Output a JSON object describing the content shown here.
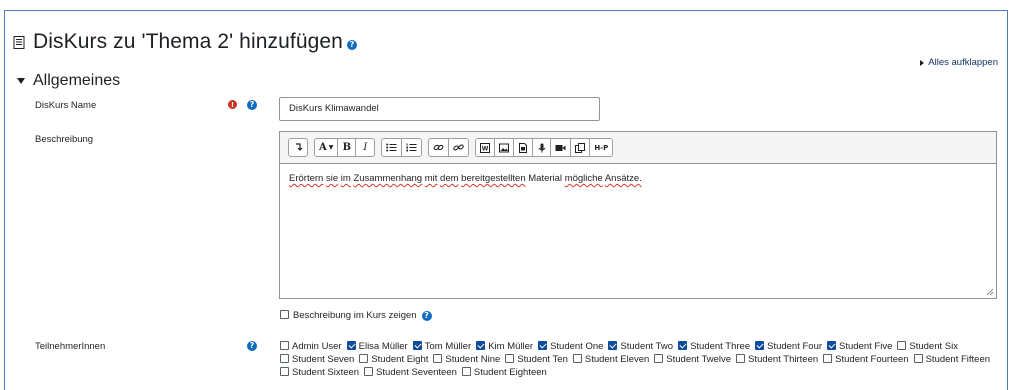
{
  "header": {
    "title": "DisKurs zu 'Thema 2' hinzufügen",
    "expand_all": "Alles aufklappen"
  },
  "section": {
    "title": "Allgemeines"
  },
  "name_field": {
    "label": "DisKurs Name",
    "value": "DisKurs Klimawandel"
  },
  "description": {
    "label": "Beschreibung",
    "toolbar_icons": [
      [
        "collapse-icon"
      ],
      [
        "font-style-icon",
        "bold-icon",
        "italic-icon"
      ],
      [
        "unordered-list-icon",
        "ordered-list-icon"
      ],
      [
        "link-icon",
        "unlink-icon"
      ],
      [
        "emoji-icon",
        "image-icon",
        "media-icon",
        "record-audio-icon",
        "record-video-icon",
        "manage-files-icon",
        "h5p-icon"
      ]
    ],
    "content_words": [
      {
        "text": "Erörtern",
        "misspelled": true
      },
      {
        "text": "sie",
        "misspelled": true
      },
      {
        "text": "im",
        "misspelled": true
      },
      {
        "text": "Zusammenhang",
        "misspelled": true
      },
      {
        "text": "mit",
        "misspelled": true
      },
      {
        "text": "dem",
        "misspelled": true
      },
      {
        "text": "bereitgestellten",
        "misspelled": true
      },
      {
        "text": "Material",
        "misspelled": false
      },
      {
        "text": "mögliche",
        "misspelled": true
      },
      {
        "text": "Ansätze.",
        "misspelled": true
      }
    ],
    "show_in_course": {
      "label": "Beschreibung im Kurs zeigen",
      "checked": false
    }
  },
  "participants": {
    "label": "TeilnehmerInnen",
    "items": [
      {
        "name": "Admin User",
        "checked": false
      },
      {
        "name": "Elisa Müller",
        "checked": true
      },
      {
        "name": "Tom Müller",
        "checked": true
      },
      {
        "name": "Kim Müller",
        "checked": true
      },
      {
        "name": "Student One",
        "checked": true
      },
      {
        "name": "Student Two",
        "checked": true
      },
      {
        "name": "Student Three",
        "checked": true
      },
      {
        "name": "Student Four",
        "checked": true
      },
      {
        "name": "Student Five",
        "checked": true
      },
      {
        "name": "Student Six",
        "checked": false
      },
      {
        "name": "Student Seven",
        "checked": false
      },
      {
        "name": "Student Eight",
        "checked": false
      },
      {
        "name": "Student Nine",
        "checked": false
      },
      {
        "name": "Student Ten",
        "checked": false
      },
      {
        "name": "Student Eleven",
        "checked": false
      },
      {
        "name": "Student Twelve",
        "checked": false
      },
      {
        "name": "Student Thirteen",
        "checked": false
      },
      {
        "name": "Student Fourteen",
        "checked": false
      },
      {
        "name": "Student Fifteen",
        "checked": false
      },
      {
        "name": "Student Sixteen",
        "checked": false
      },
      {
        "name": "Student Seventeen",
        "checked": false
      },
      {
        "name": "Student Eighteen",
        "checked": false
      }
    ]
  },
  "colors": {
    "accent": "#0f6cbf",
    "required": "#ca3120",
    "checkbox_checked": "#0f4c9c",
    "frame_border": "#4f7fbf"
  }
}
